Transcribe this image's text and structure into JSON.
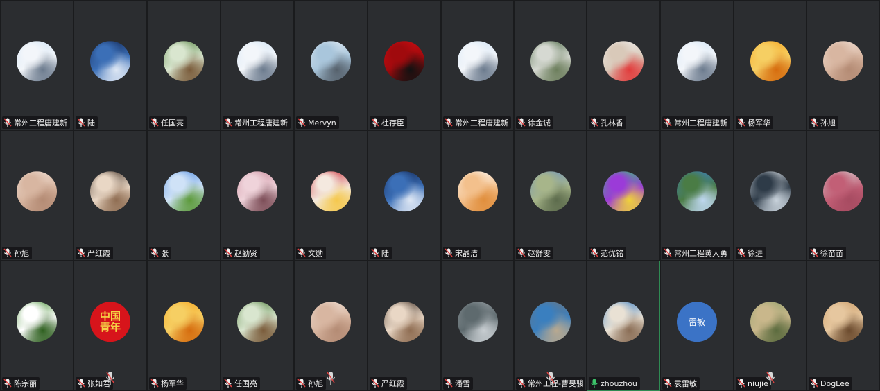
{
  "meeting": {
    "participants": [
      {
        "name": "常州工程唐建新",
        "avatar": "snow-person-photo",
        "colors": [
          "#cfe3f5",
          "#f3f6fa",
          "#6b7a8d"
        ],
        "mic": "muted"
      },
      {
        "name": "陆",
        "avatar": "lighthouse-photo",
        "colors": [
          "#10224d",
          "#3b6fb7",
          "#dfe8f5"
        ],
        "mic": "muted"
      },
      {
        "name": "任国亮",
        "avatar": "garden-pavilion-photo",
        "colors": [
          "#4f7e3b",
          "#d9e6cf",
          "#7a5b3a"
        ],
        "mic": "muted"
      },
      {
        "name": "常州工程唐建新",
        "avatar": "snow-person-photo",
        "colors": [
          "#cfe3f5",
          "#f3f6fa",
          "#6b7a8d"
        ],
        "mic": "muted"
      },
      {
        "name": "Mervyn",
        "avatar": "white-bird-photo",
        "colors": [
          "#e8eef4",
          "#a9c6dc",
          "#55606b"
        ],
        "mic": "muted"
      },
      {
        "name": "杜存臣",
        "avatar": "red-calligraphy-logo",
        "colors": [
          "#d10d12",
          "#a00a0d",
          "#111111"
        ],
        "mic": "muted"
      },
      {
        "name": "常州工程唐建新",
        "avatar": "snow-person-photo",
        "colors": [
          "#cfe3f5",
          "#f3f6fa",
          "#6b7a8d"
        ],
        "mic": "muted"
      },
      {
        "name": "徐金诚",
        "avatar": "forest-person-photo",
        "colors": [
          "#3e5e37",
          "#d6d9d2",
          "#6c7e5c"
        ],
        "mic": "muted"
      },
      {
        "name": "孔林香",
        "avatar": "white-illustration",
        "colors": [
          "#f2f2f2",
          "#d9c9b9",
          "#e23b3b"
        ],
        "mic": "muted"
      },
      {
        "name": "常州工程唐建新",
        "avatar": "snow-person-photo",
        "colors": [
          "#cfe3f5",
          "#f3f6fa",
          "#6b7a8d"
        ],
        "mic": "muted"
      },
      {
        "name": "杨军华",
        "avatar": "sunset-beach-photo",
        "colors": [
          "#f7a11b",
          "#f6cf63",
          "#d66c0e"
        ],
        "mic": "muted"
      },
      {
        "name": "孙旭",
        "avatar": "baby-photo",
        "colors": [
          "#f1e2d8",
          "#d8b6a1",
          "#b48b74"
        ],
        "mic": "muted"
      },
      {
        "name": "孙旭",
        "avatar": "baby-photo",
        "colors": [
          "#f1e2d8",
          "#d8b6a1",
          "#b48b74"
        ],
        "mic": "muted"
      },
      {
        "name": "严红霞",
        "avatar": "child-photo",
        "colors": [
          "#3a2a20",
          "#e9d7c5",
          "#8f6d52"
        ],
        "mic": "muted"
      },
      {
        "name": "张",
        "avatar": "green-field-photo",
        "colors": [
          "#4d8be0",
          "#cfe2f7",
          "#5c9a3a"
        ],
        "mic": "muted"
      },
      {
        "name": "赵勤贤",
        "avatar": "cherry-blossom-photo",
        "colors": [
          "#c98a9a",
          "#efd3da",
          "#7c4d57"
        ],
        "mic": "muted"
      },
      {
        "name": "文勋",
        "avatar": "red-cartoon-avatar",
        "colors": [
          "#c81e2b",
          "#f4e9df",
          "#f5c84c"
        ],
        "mic": "muted"
      },
      {
        "name": "陆",
        "avatar": "lighthouse-photo",
        "colors": [
          "#10224d",
          "#3b6fb7",
          "#dfe8f5"
        ],
        "mic": "muted"
      },
      {
        "name": "宋晶洁",
        "avatar": "cute-bird-drawing",
        "colors": [
          "#ffffff",
          "#f3c08c",
          "#e08e3c"
        ],
        "mic": "muted"
      },
      {
        "name": "赵舒雯",
        "avatar": "valley-town-photo",
        "colors": [
          "#6e93c2",
          "#a7b58a",
          "#5c6b4c"
        ],
        "mic": "muted"
      },
      {
        "name": "范优铭",
        "avatar": "colorful-character",
        "colors": [
          "#2fd06a",
          "#9b3bd8",
          "#f0d23a"
        ],
        "mic": "muted"
      },
      {
        "name": "常州工程黄大勇",
        "avatar": "mountain-cliff-photo",
        "colors": [
          "#3a7fd1",
          "#4a7c45",
          "#bfd8f0"
        ],
        "mic": "muted"
      },
      {
        "name": "徐进",
        "avatar": "skier-photo",
        "colors": [
          "#e9eef3",
          "#2e3b48",
          "#c9d3dc"
        ],
        "mic": "muted"
      },
      {
        "name": "徐苗苗",
        "avatar": "pink-plush-photo",
        "colors": [
          "#d7d7d7",
          "#c25f76",
          "#a74b61"
        ],
        "mic": "muted"
      },
      {
        "name": "陈宗丽",
        "avatar": "white-flower-photo",
        "colors": [
          "#3f8a2b",
          "#ffffff",
          "#2d5f1e"
        ],
        "mic": "muted"
      },
      {
        "name": "张如君",
        "avatar": "youth-logo",
        "colors": [
          "#d7141b",
          "#f5d245",
          "#b30f14"
        ],
        "mic": "muted",
        "text": "中国\n青年"
      },
      {
        "name": "杨军华",
        "avatar": "sunset-beach-photo",
        "colors": [
          "#f7a11b",
          "#f6cf63",
          "#d66c0e"
        ],
        "mic": "muted"
      },
      {
        "name": "任国亮",
        "avatar": "garden-pavilion-photo",
        "colors": [
          "#4f7e3b",
          "#d9e6cf",
          "#7a5b3a"
        ],
        "mic": "muted"
      },
      {
        "name": "孙旭",
        "avatar": "baby-photo",
        "colors": [
          "#f1e2d8",
          "#d8b6a1",
          "#b48b74"
        ],
        "mic": "muted"
      },
      {
        "name": "严红霞",
        "avatar": "child-photo",
        "colors": [
          "#3a2a20",
          "#e9d7c5",
          "#8f6d52"
        ],
        "mic": "muted"
      },
      {
        "name": "潘雪",
        "avatar": "foggy-road-photo",
        "colors": [
          "#9aa1a6",
          "#5e6a6e",
          "#c8ced2"
        ],
        "mic": "muted"
      },
      {
        "name": "常州工程-曹旻骏",
        "avatar": "rocky-shore-photo",
        "colors": [
          "#6f7479",
          "#3a7fbf",
          "#b9a98f"
        ],
        "mic": "muted"
      },
      {
        "name": "zhouzhou",
        "avatar": "beach-couple-photo",
        "colors": [
          "#2f78c2",
          "#e9e1d4",
          "#8a6d55"
        ],
        "mic": "active"
      },
      {
        "name": "袁雷敏",
        "avatar": "initials",
        "colors": [
          "#3b73c6",
          "#3b73c6",
          "#3b73c6"
        ],
        "mic": "muted",
        "text": "雷敏"
      },
      {
        "name": "niujie",
        "avatar": "town-aerial-photo",
        "colors": [
          "#8fa06b",
          "#c9b78b",
          "#5b6b3e"
        ],
        "mic": "muted"
      },
      {
        "name": "DogLee",
        "avatar": "dog-photo",
        "colors": [
          "#c89863",
          "#e6c79f",
          "#6b4a2d"
        ],
        "mic": "muted"
      }
    ]
  },
  "colors": {
    "background": "#1f2022",
    "tile": "#2b2d30",
    "active_border": "#2f8a53",
    "muted_mic": "#e04040",
    "active_mic": "#3cc46a"
  }
}
